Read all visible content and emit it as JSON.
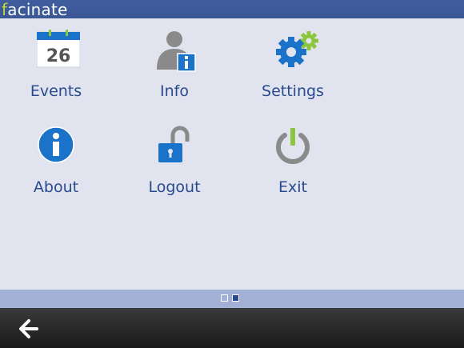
{
  "app": {
    "logo_first": "f",
    "logo_rest": "acinate"
  },
  "menu": [
    {
      "label": "Events",
      "icon": "calendar-icon",
      "icon_text": "26"
    },
    {
      "label": "Info",
      "icon": "user-info-icon"
    },
    {
      "label": "Settings",
      "icon": "gears-icon"
    },
    {
      "label": "About",
      "icon": "about-info-icon"
    },
    {
      "label": "Logout",
      "icon": "unlock-icon"
    },
    {
      "label": "Exit",
      "icon": "power-icon"
    }
  ],
  "pager": {
    "pages": 2,
    "current": 2
  },
  "toolbar": {
    "back_icon": "back-arrow-icon"
  },
  "colors": {
    "titlebar": "#3b5895",
    "background": "#e1e4ef",
    "label": "#2a4a8e",
    "icon_blue": "#1a73c9",
    "accent_green": "#8cc63f",
    "pager_bg": "#a3b0d6",
    "toolbar": "#222222"
  }
}
